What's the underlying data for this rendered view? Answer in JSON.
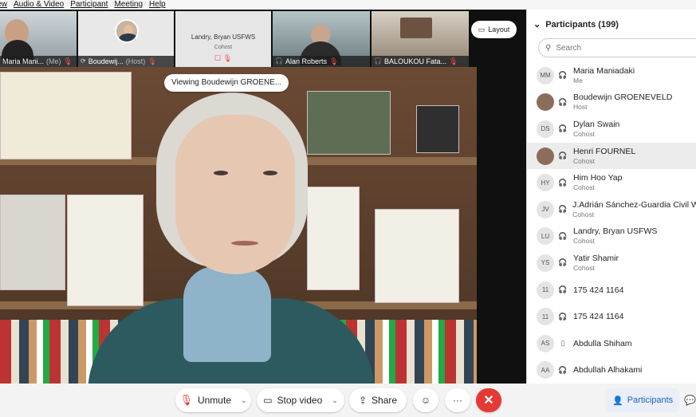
{
  "menu": [
    "iew",
    "Audio & Video",
    "Participant",
    "Meeting",
    "Help"
  ],
  "thumbnails": [
    {
      "name": "Maria Mani...",
      "role": "(Me)"
    },
    {
      "name": "Boudewij...",
      "role": "(Host)"
    },
    {
      "name": "Landry, Bryan USFWS",
      "role": "Cohost"
    },
    {
      "name": "Alan Roberts",
      "role": ""
    },
    {
      "name": "BALOUKOU Fata...",
      "role": ""
    }
  ],
  "layout_button": "Layout",
  "viewing_label": "Viewing Boudewijn GROENE...",
  "controls": {
    "unmute": "Unmute",
    "stop_video": "Stop video",
    "share": "Share",
    "reactions_icon": "smiley-icon",
    "more": "···",
    "leave": "✕",
    "participants": "Participants"
  },
  "panel": {
    "title": "Participants (199)",
    "search_placeholder": "Search",
    "participants": [
      {
        "initials": "MM",
        "name": "Maria Maniadaki",
        "role": "Me",
        "photo": false
      },
      {
        "initials": "",
        "name": "Boudewijn GROENEVELD",
        "role": "Host",
        "photo": true
      },
      {
        "initials": "DS",
        "name": "Dylan Swain",
        "role": "Cohost",
        "photo": false
      },
      {
        "initials": "",
        "name": "Henri FOURNEL",
        "role": "Cohost",
        "photo": true
      },
      {
        "initials": "HY",
        "name": "Him Hoo Yap",
        "role": "Cohost",
        "photo": false
      },
      {
        "initials": "JV",
        "name": "J.Adrián Sánchez-Guardia Civil WC",
        "role": "Cohost",
        "photo": false
      },
      {
        "initials": "LU",
        "name": "Landry, Bryan USFWS",
        "role": "Cohost",
        "photo": false
      },
      {
        "initials": "YS",
        "name": "Yatir Shamir",
        "role": "Cohost",
        "photo": false
      },
      {
        "initials": "11",
        "name": "175 424 1164",
        "role": "",
        "photo": false
      },
      {
        "initials": "11",
        "name": "175 424 1164",
        "role": "",
        "photo": false
      },
      {
        "initials": "AS",
        "name": "Abdulla Shiham",
        "role": "",
        "photo": false
      },
      {
        "initials": "AA",
        "name": "Abdullah Alhakami",
        "role": "",
        "photo": false
      }
    ]
  },
  "colors": {
    "leave": "#e53935",
    "mute": "#e53935",
    "accent": "#1f5fbf"
  }
}
